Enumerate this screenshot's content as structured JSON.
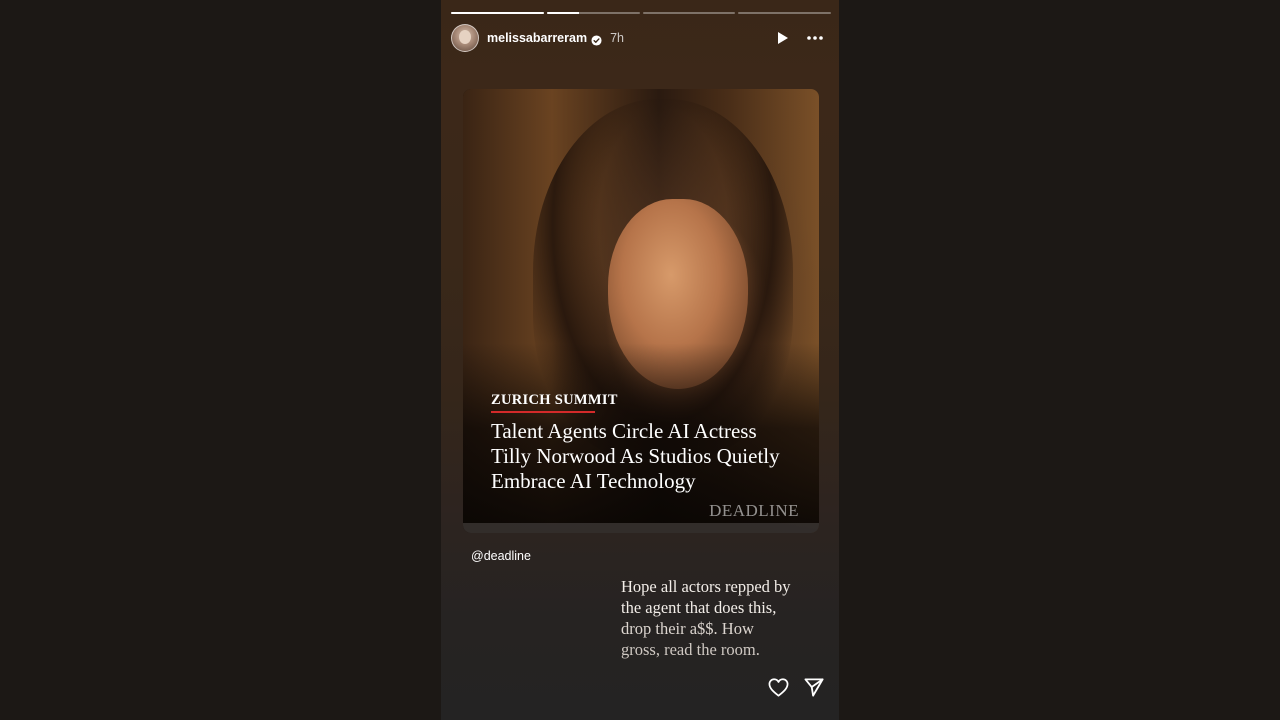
{
  "story": {
    "progress": [
      1.0,
      0.35,
      0.0,
      0.0
    ],
    "header": {
      "username": "melissabarreram",
      "time": "7h"
    },
    "card": {
      "kicker": "ZURICH SUMMIT",
      "headline": "Talent Agents Circle AI Actress Tilly Norwood As Studios Quietly Embrace AI Technology",
      "brand": "DEADLINE"
    },
    "mention": "@deadline",
    "caption": {
      "line1": "Hope all actors repped by",
      "line2": "the agent that does this,",
      "line3": "drop their a$$. How",
      "line4": "gross, read the room."
    },
    "icons": {
      "verified": "verified-badge-icon",
      "play": "play-icon",
      "more": "more-options-icon",
      "like": "heart-icon",
      "share": "send-icon"
    },
    "colors": {
      "kicker_rule": "#d42a2a",
      "background": "#1c1815"
    }
  }
}
